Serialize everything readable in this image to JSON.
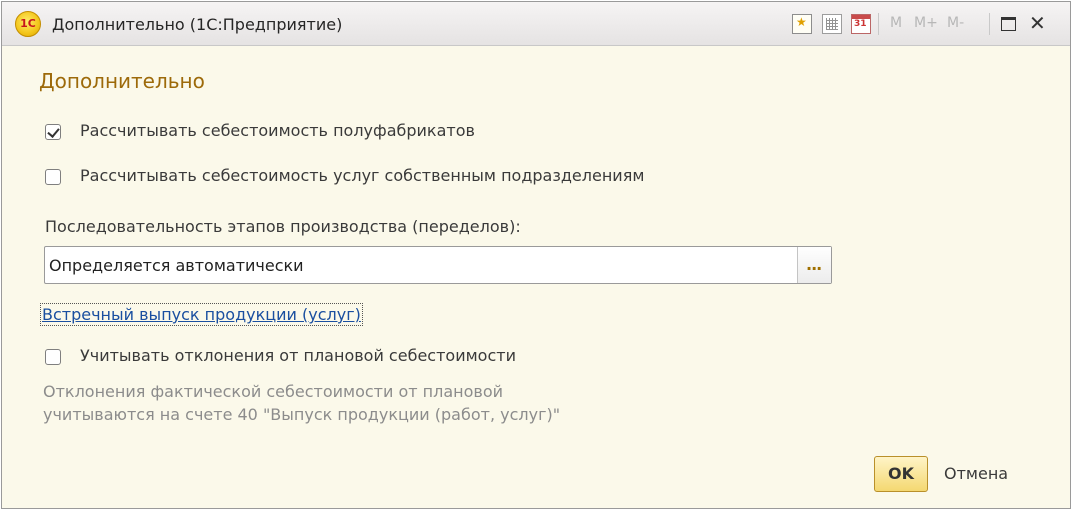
{
  "window": {
    "title": "Дополнительно (1С:Предприятие)",
    "logo_text": "1С",
    "toolbar": {
      "calendar_day": "31",
      "memory_buttons": [
        "M",
        "M+",
        "M-"
      ]
    }
  },
  "form": {
    "title": "Дополнительно",
    "checkboxes": [
      {
        "label": "Рассчитывать себестоимость полуфабрикатов",
        "checked": true
      },
      {
        "label": "Рассчитывать себестоимость услуг собственным подразделениям",
        "checked": false
      }
    ],
    "sequence_label": "Последовательность этапов производства (переделов):",
    "sequence_value": "Определяется автоматически",
    "select_button_label": "...",
    "counter_output_link": "Встречный выпуск продукции (услуг)",
    "deviation_checkbox": {
      "label": "Учитывать отклонения от плановой себестоимости",
      "checked": false
    },
    "note_lines": [
      "Отклонения фактической себестоимости от плановой",
      "учитываются на счете 40 \"Выпуск продукции (работ, услуг)\""
    ]
  },
  "buttons": {
    "ok": "OK",
    "cancel": "Отмена"
  },
  "colors": {
    "background": "#fbf9ea",
    "title": "#9d6a0a",
    "link": "#1a4fa0",
    "note": "#8c8c8c",
    "ok_button": "#f4d871"
  }
}
